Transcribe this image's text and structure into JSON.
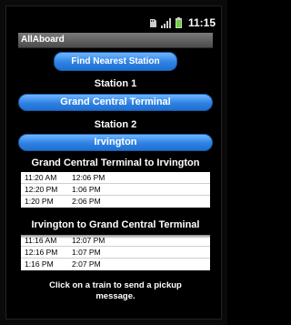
{
  "status_bar": {
    "time": "11:15"
  },
  "app": {
    "title": "AllAboard"
  },
  "find_button": {
    "label": "Find Nearest Station"
  },
  "station1": {
    "heading": "Station 1",
    "value": "Grand Central Terminal"
  },
  "station2": {
    "heading": "Station 2",
    "value": "Irvington"
  },
  "schedule1": {
    "title": "Grand Central Terminal to Irvington",
    "rows": [
      {
        "depart": "11:20 AM",
        "arrive": "12:06 PM"
      },
      {
        "depart": "12:20 PM",
        "arrive": "1:06 PM"
      },
      {
        "depart": "1:20 PM",
        "arrive": "2:06 PM"
      }
    ]
  },
  "schedule2": {
    "title": "Irvington to Grand Central Terminal",
    "rows": [
      {
        "depart": "11:16 AM",
        "arrive": "12:07 PM"
      },
      {
        "depart": "12:16 PM",
        "arrive": "1:07 PM"
      },
      {
        "depart": "1:16 PM",
        "arrive": "2:07 PM"
      }
    ]
  },
  "footer": {
    "line1": "Click on a train to send a pickup",
    "line2": "message."
  },
  "colors": {
    "button_blue": "#2e82e3",
    "title_bar": "#5a5a5a",
    "battery_green": "#6fd03b"
  }
}
